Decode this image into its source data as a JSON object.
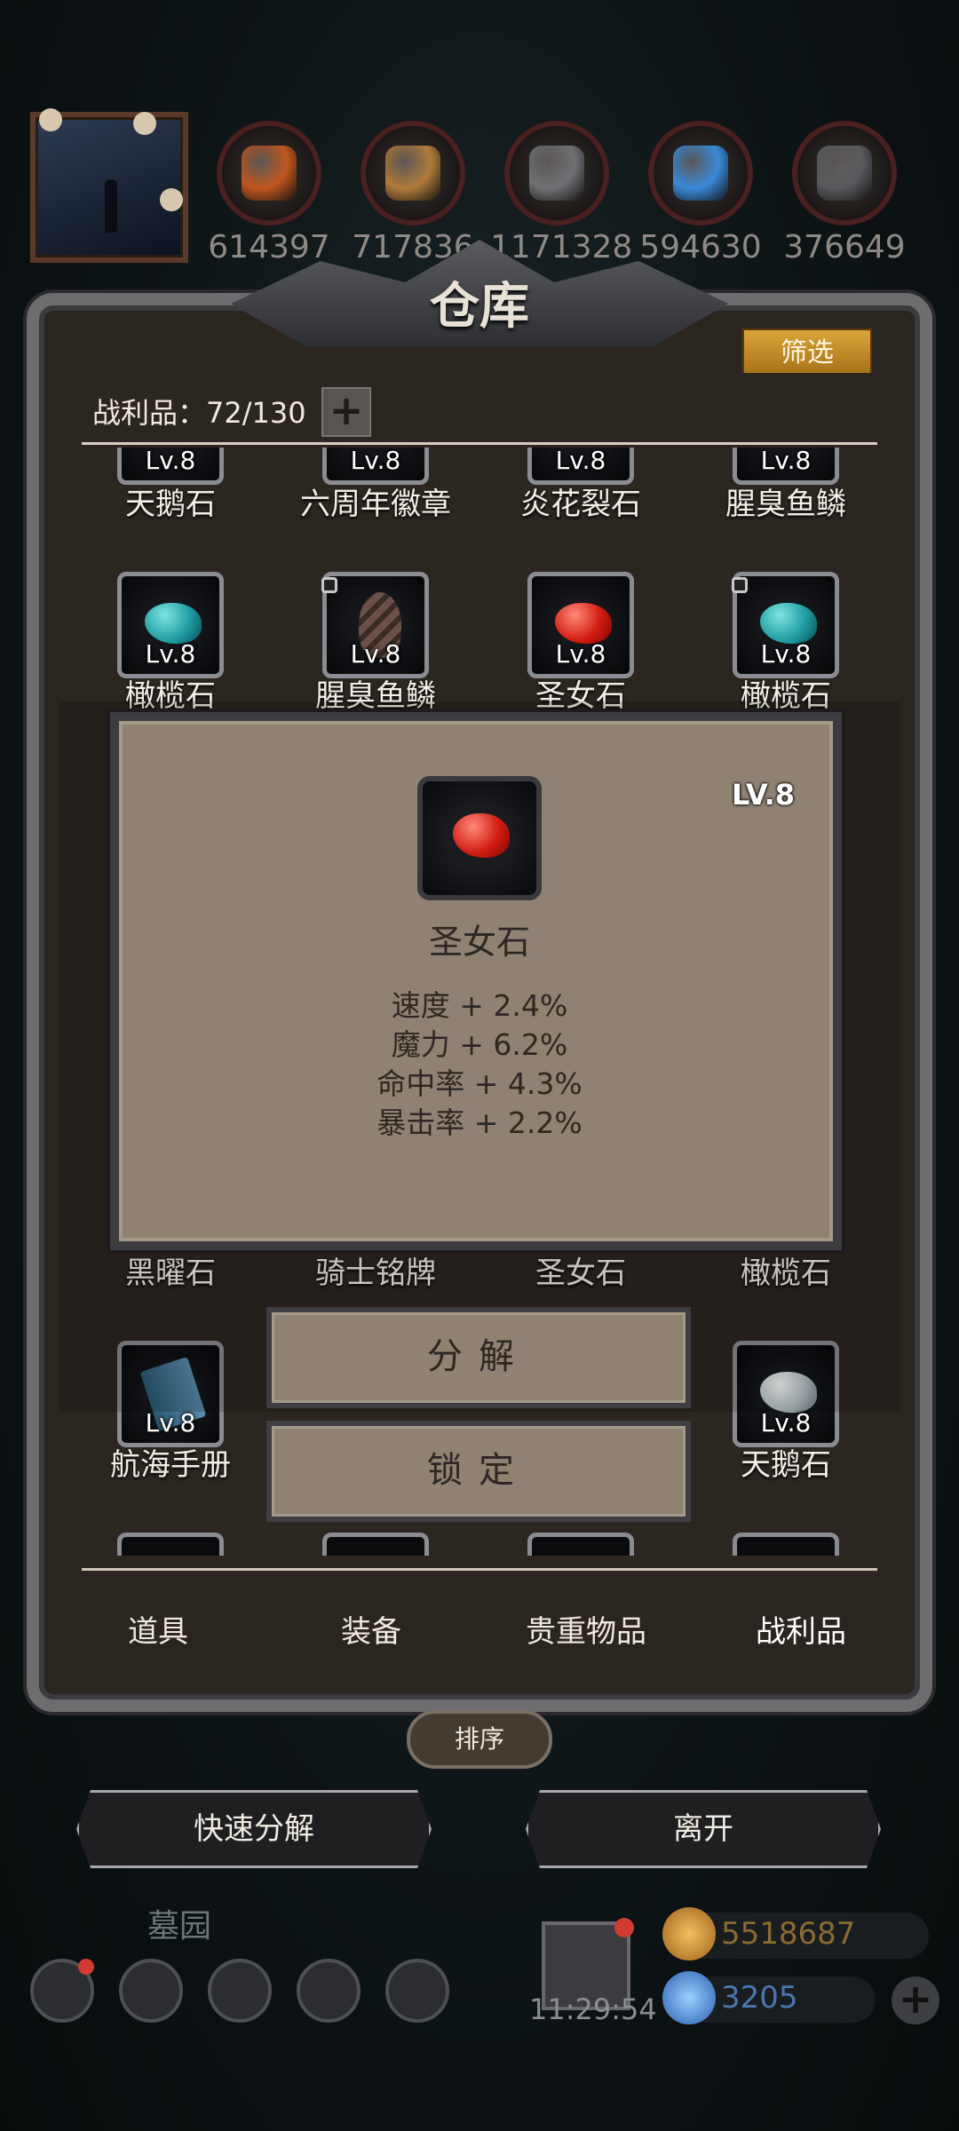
{
  "resources": [
    {
      "icon": "ore-icon",
      "value": "614397",
      "color": "#c0561e"
    },
    {
      "icon": "wood-icon",
      "value": "717836",
      "color": "#b07b3a"
    },
    {
      "icon": "stone-icon",
      "value": "1171328",
      "color": "#707074"
    },
    {
      "icon": "crystal-icon",
      "value": "594630",
      "color": "#3a8ad8"
    },
    {
      "icon": "iron-icon",
      "value": "376649",
      "color": "#5a5a5e"
    }
  ],
  "panel": {
    "title": "仓库",
    "filter_label": "筛选",
    "loot_label": "战利品：72/130",
    "add_capacity": "+",
    "sort_label": "排序"
  },
  "grid": {
    "row1_partial": [
      {
        "lv": "Lv.8",
        "name": "天鹅石"
      },
      {
        "lv": "Lv.8",
        "name": "六周年徽章"
      },
      {
        "lv": "Lv.8",
        "name": "炎花裂石"
      },
      {
        "lv": "Lv.8",
        "name": "腥臭鱼鳞"
      }
    ],
    "row2": [
      {
        "lv": "Lv.8",
        "name": "橄榄石",
        "stone_color": "#1f9ea4",
        "locked": false
      },
      {
        "lv": "Lv.8",
        "name": "腥臭鱼鳞",
        "stone_color": "#5a4540",
        "locked": true
      },
      {
        "lv": "Lv.8",
        "name": "圣女石",
        "stone_color": "#d4261a",
        "locked": false
      },
      {
        "lv": "Lv.8",
        "name": "橄榄石",
        "stone_color": "#1f9ea4",
        "locked": true
      }
    ],
    "row4_names": [
      "黑曜石",
      "骑士铭牌",
      "圣女石",
      "橄榄石"
    ],
    "row5": [
      {
        "lv": "Lv.8",
        "name": "航海手册",
        "stone_color": "#3f6f8c"
      },
      {
        "lv": "Lv.8",
        "name": "天鹅石",
        "stone_color": "#b8c4c8"
      }
    ]
  },
  "popup": {
    "level": "LV.8",
    "item_name": "圣女石",
    "stats": [
      "速度 + 2.4%",
      "魔力 + 6.2%",
      "命中率 + 4.3%",
      "暴击率 + 2.2%"
    ]
  },
  "context_menu": {
    "decompose_label": "分解",
    "lock_label": "锁定"
  },
  "tabs": [
    {
      "label": "道具",
      "active": false
    },
    {
      "label": "装备",
      "active": false
    },
    {
      "label": "贵重物品",
      "active": false
    },
    {
      "label": "战利品",
      "active": true
    }
  ],
  "actions": {
    "quick_decompose": "快速分解",
    "leave": "离开"
  },
  "hud": {
    "area_name": "墓园",
    "timer": "11:29:54",
    "gold": "5518687",
    "gems": "3205",
    "gold_color": "#c8862a",
    "gem_color": "#3a7fd0"
  }
}
